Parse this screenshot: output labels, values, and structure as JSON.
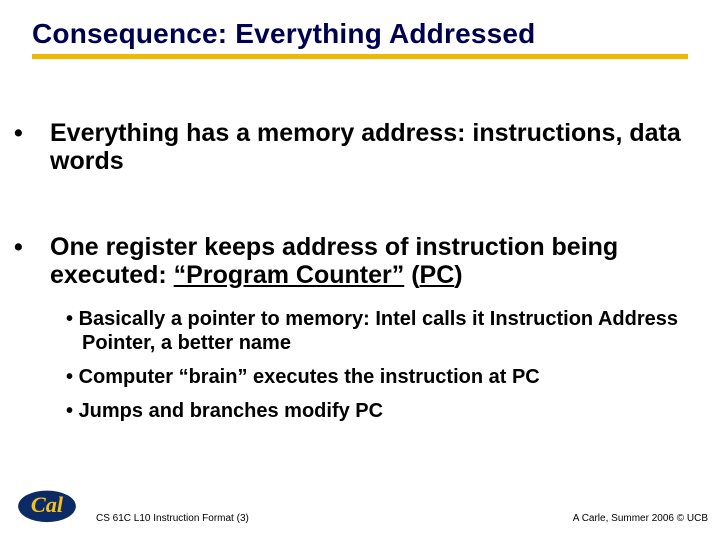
{
  "title": "Consequence: Everything Addressed",
  "bullets": {
    "b1a": "Everything has a memory address: instructions, data words",
    "b1b_pre": "One register keeps address of instruction being executed: ",
    "b1b_q1": "“Program Counter”",
    "b1b_sp": " (",
    "b1b_pc": "PC",
    "b1b_cl": ")",
    "sub1": "Basically a pointer to memory: Intel calls it Instruction Address Pointer, a better name",
    "sub2": "Computer “brain” executes the instruction at PC",
    "sub3": "Jumps and branches modify PC"
  },
  "footer": {
    "left": "CS 61C L10 Instruction Format (3)",
    "right": "A Carle, Summer 2006 © UCB"
  }
}
